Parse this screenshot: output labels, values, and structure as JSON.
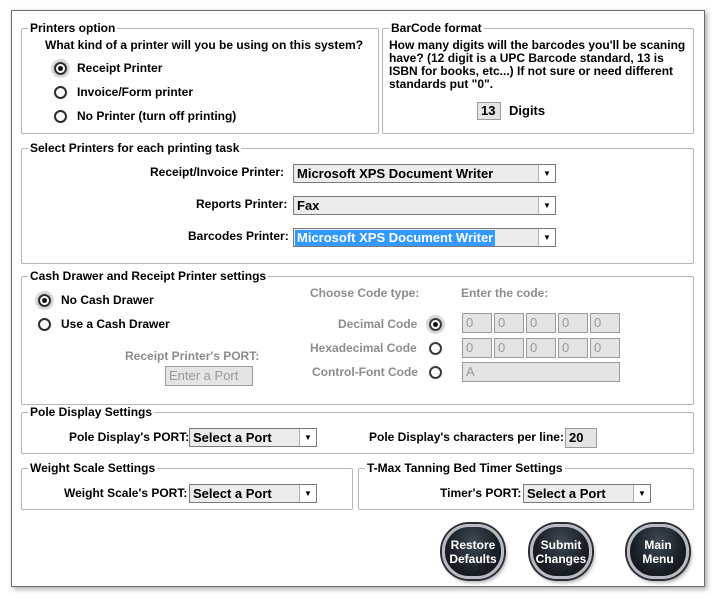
{
  "printers_option": {
    "title": "Printers option",
    "question": "What kind of a  printer will you be using on this system?",
    "options": [
      "Receipt Printer",
      "Invoice/Form printer",
      "No Printer (turn off printing)"
    ]
  },
  "barcode_format": {
    "title": "BarCode format",
    "description_lines": [
      "How many digits will the barcodes you'll be scaning",
      "have? (12 digit is a UPC Barcode standard, 13 is",
      "ISBN for books, etc...)  If not sure or need different",
      "standards put \"0\"."
    ],
    "digits_value": "13",
    "digits_label": "Digits"
  },
  "select_printers": {
    "title": "Select Printers for each printing task",
    "rows": [
      {
        "label": "Receipt/Invoice Printer:",
        "value": "Microsoft XPS Document Writer"
      },
      {
        "label": "Reports Printer:",
        "value": "Fax"
      },
      {
        "label": "Barcodes Printer:",
        "value": "Microsoft XPS Document Writer"
      }
    ]
  },
  "cash_drawer": {
    "title": "Cash Drawer and Receipt Printer settings",
    "options": [
      "No Cash Drawer",
      "Use a Cash Drawer"
    ],
    "choose_code_type": "Choose Code type:",
    "enter_code": "Enter the code:",
    "code_types": [
      "Decimal Code",
      "Hexadecimal Code",
      "Control-Font Code"
    ],
    "decimal_values": [
      "0",
      "0",
      "0",
      "0",
      "0"
    ],
    "hex_values": [
      "0",
      "0",
      "0",
      "0",
      "0"
    ],
    "control_font_value": "A",
    "port_label": "Receipt Printer's PORT:",
    "port_placeholder": "Enter a Port"
  },
  "pole_display": {
    "title": "Pole Display Settings",
    "port_label": "Pole Display's PORT:",
    "port_value": "Select a Port",
    "chars_label": "Pole Display's characters per line:",
    "chars_value": "20"
  },
  "weight_scale": {
    "title": "Weight Scale Settings",
    "port_label": "Weight Scale's PORT:",
    "port_value": "Select a Port"
  },
  "tmax_timer": {
    "title": "T-Max Tanning Bed Timer Settings",
    "port_label": "Timer's PORT:",
    "port_value": "Select a Port"
  },
  "buttons": {
    "restore": [
      "Restore",
      "Defaults"
    ],
    "submit": [
      "Submit",
      "Changes"
    ],
    "main_menu": [
      "Main",
      "Menu"
    ]
  },
  "icons": {
    "dropdown": "chevron-down-icon"
  }
}
